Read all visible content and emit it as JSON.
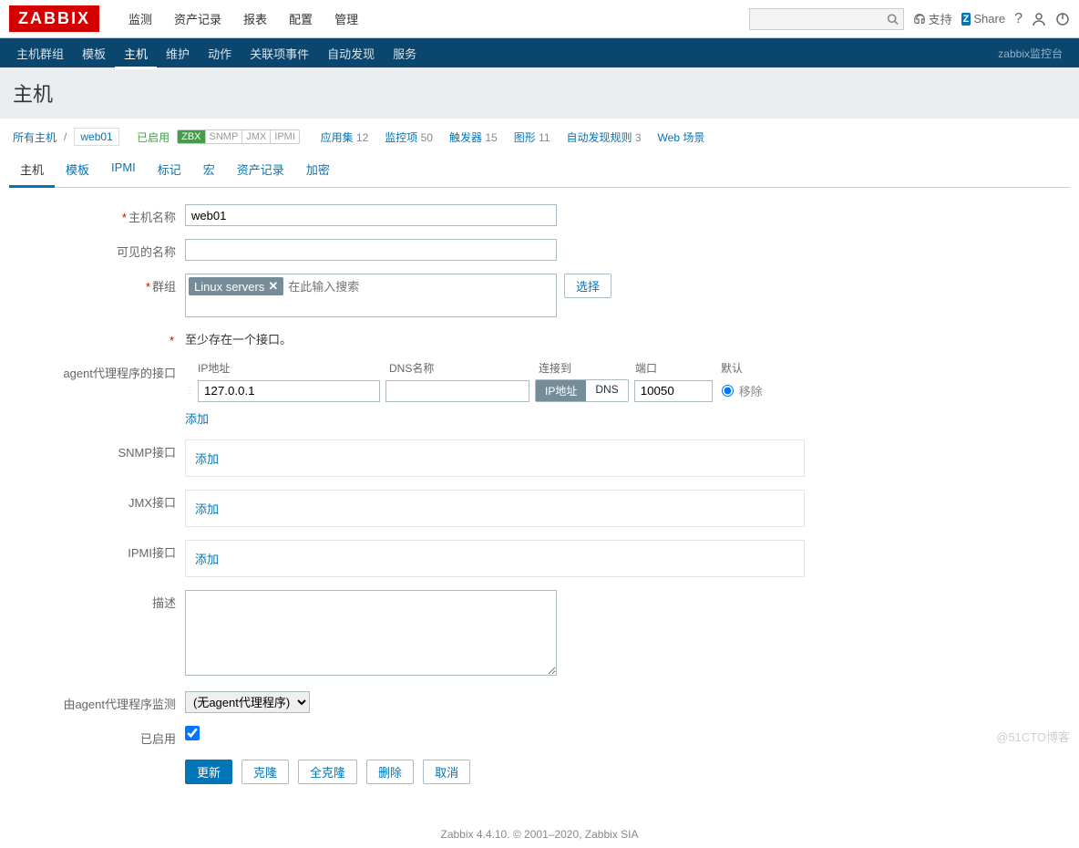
{
  "logo": "ZABBIX",
  "topMenu": [
    "监测",
    "资产记录",
    "报表",
    "配置",
    "管理"
  ],
  "topMenuActive": 3,
  "topRight": {
    "support": "支持",
    "share": "Share"
  },
  "subMenu": [
    "主机群组",
    "模板",
    "主机",
    "维护",
    "动作",
    "关联项事件",
    "自动发现",
    "服务"
  ],
  "subMenuActive": 2,
  "subNavRight": "zabbix监控台",
  "pageTitle": "主机",
  "breadcrumb": {
    "allHosts": "所有主机",
    "host": "web01",
    "enabled": "已启用",
    "avail": [
      {
        "name": "ZBX",
        "on": true
      },
      {
        "name": "SNMP",
        "on": false
      },
      {
        "name": "JMX",
        "on": false
      },
      {
        "name": "IPMI",
        "on": false
      }
    ],
    "links": [
      {
        "label": "应用集",
        "count": "12"
      },
      {
        "label": "监控项",
        "count": "50"
      },
      {
        "label": "触发器",
        "count": "15"
      },
      {
        "label": "图形",
        "count": "11"
      },
      {
        "label": "自动发现规则",
        "count": "3"
      },
      {
        "label": "Web 场景",
        "count": ""
      }
    ]
  },
  "tabs": [
    "主机",
    "模板",
    "IPMI",
    "标记",
    "宏",
    "资产记录",
    "加密"
  ],
  "tabActive": 0,
  "form": {
    "hostNameLabel": "主机名称",
    "hostName": "web01",
    "visibleNameLabel": "可见的名称",
    "visibleName": "",
    "groupsLabel": "群组",
    "groupTag": "Linux servers",
    "groupPlaceholder": "在此输入搜索",
    "selectBtn": "选择",
    "ifaceNote": "至少存在一个接口。",
    "agentLabel": "agent代理程序的接口",
    "ifaceHeaders": {
      "ip": "IP地址",
      "dns": "DNS名称",
      "conn": "连接到",
      "port": "端口",
      "default": "默认"
    },
    "agentIface": {
      "ip": "127.0.0.1",
      "dns": "",
      "connIp": "IP地址",
      "connDns": "DNS",
      "port": "10050",
      "remove": "移除"
    },
    "addLink": "添加",
    "snmpLabel": "SNMP接口",
    "jmxLabel": "JMX接口",
    "ipmiLabel": "IPMI接口",
    "descLabel": "描述",
    "desc": "",
    "proxyLabel": "由agent代理程序监测",
    "proxyValue": "(无agent代理程序)",
    "enabledLabel": "已启用",
    "enabled": true,
    "buttons": {
      "update": "更新",
      "clone": "克隆",
      "fullClone": "全克隆",
      "delete": "删除",
      "cancel": "取消"
    }
  },
  "footer": "Zabbix 4.4.10. © 2001–2020, Zabbix SIA",
  "watermark": "@51CTO博客"
}
